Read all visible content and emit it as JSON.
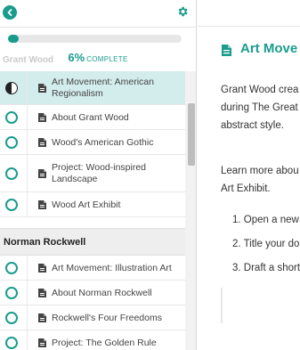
{
  "sidebar": {
    "progress": {
      "percent": "6%",
      "label": "COMPLETE",
      "fraction": 0.06
    },
    "prev_section_label": "Grant Wood",
    "items": [
      {
        "label": "Art Movement: American Regionalism",
        "status": "in-progress",
        "active": true
      },
      {
        "label": "About Grant Wood",
        "status": "not-started",
        "active": false
      },
      {
        "label": "Wood's American Gothic",
        "status": "not-started",
        "active": false
      },
      {
        "label": "Project: Wood-inspired Landscape",
        "status": "not-started",
        "active": false
      },
      {
        "label": "Wood Art Exhibit",
        "status": "not-started",
        "active": false
      }
    ],
    "section": {
      "title": "Norman Rockwell",
      "items": [
        {
          "label": "Art Movement: Illustration Art",
          "status": "not-started"
        },
        {
          "label": "About Norman Rockwell",
          "status": "not-started"
        },
        {
          "label": "Rockwell's Four Freedoms",
          "status": "not-started"
        },
        {
          "label": "Project: The Golden Rule",
          "status": "not-started"
        }
      ]
    }
  },
  "main": {
    "title": "Art Move",
    "paragraph1": [
      "Grant Wood crea",
      "during The Great",
      "abstract style."
    ],
    "paragraph2": [
      "Learn more abou",
      "Art Exhibit."
    ],
    "steps": [
      "1. Open a new",
      "2. Title your do",
      "3. Draft a short"
    ]
  },
  "colors": {
    "accent": "#1a9c8c",
    "active_row": "#d3ecec",
    "section_bg": "#eeeeee"
  },
  "icons": {
    "back": "chevron-left-icon",
    "settings": "gear-icon",
    "document": "document-icon"
  }
}
